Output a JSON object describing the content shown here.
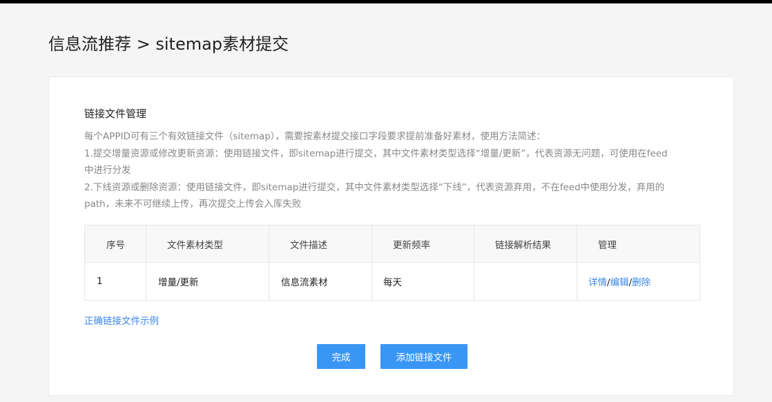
{
  "page": {
    "title": "信息流推荐 > sitemap素材提交"
  },
  "card": {
    "section_title": "链接文件管理",
    "description": [
      "每个APPID可有三个有效链接文件（sitemap），需要按素材提交接口字段要求提前准备好素材，使用方法简述：",
      "1.提交增量资源或修改更新资源：使用链接文件，即sitemap进行提交，其中文件素材类型选择“增量/更新”，代表资源无问题，可使用在feed",
      "中进行分发",
      "2.下线资源或删除资源：使用链接文件，即sitemap进行提交，其中文件素材类型选择“下线”，代表资源弃用，不在feed中使用分发，弃用的",
      "path，未来不可继续上传，再次提交上传会入库失败"
    ],
    "table": {
      "columns": [
        "序号",
        "文件素材类型",
        "文件描述",
        "更新频率",
        "链接解析结果",
        "管理"
      ],
      "rows": [
        {
          "index": "1",
          "type": "增量/更新",
          "desc": "信息流素材",
          "freq": "每天",
          "result": "",
          "actions": {
            "detail": "详情",
            "edit": "编辑",
            "delete": "删除",
            "sep": "/"
          }
        }
      ]
    },
    "example_link": "正确链接文件示例",
    "buttons": {
      "done": "完成",
      "add": "添加链接文件"
    }
  },
  "colors": {
    "link": "#3a86e8",
    "primary_button": "#3a96f5",
    "background": "#f5f5f5"
  }
}
